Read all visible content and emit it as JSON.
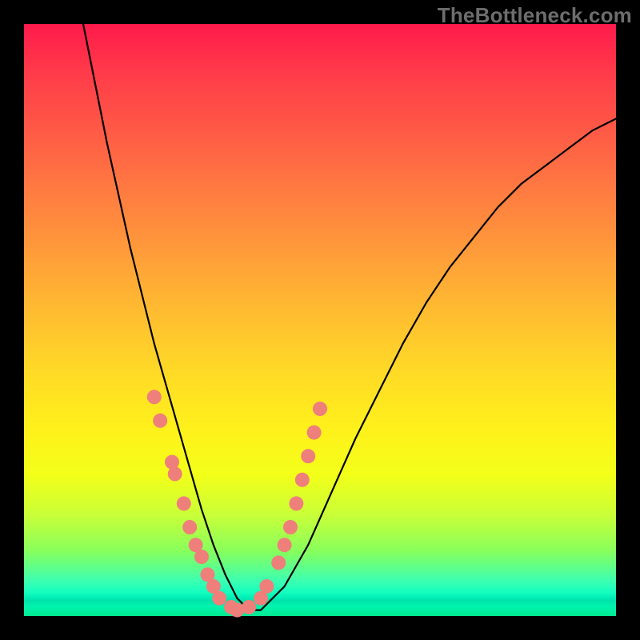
{
  "watermark": {
    "text": "TheBottleneck.com"
  },
  "chart_data": {
    "type": "line",
    "title": "",
    "xlabel": "",
    "ylabel": "",
    "xlim": [
      0,
      100
    ],
    "ylim": [
      0,
      100
    ],
    "grid": false,
    "description": "V-shaped bottleneck curve plotted over a vertical red-to-green gradient background, with salmon dots clustered near the valley.",
    "series": [
      {
        "name": "bottleneck-curve",
        "x": [
          10,
          12,
          14,
          16,
          18,
          20,
          22,
          24,
          26,
          28,
          30,
          32,
          34,
          36,
          38,
          40,
          44,
          48,
          52,
          56,
          60,
          64,
          68,
          72,
          76,
          80,
          84,
          88,
          92,
          96,
          100
        ],
        "y": [
          100,
          90,
          80,
          71,
          62,
          54,
          46,
          39,
          32,
          25,
          18,
          12,
          7,
          3,
          1,
          1,
          5,
          12,
          21,
          30,
          38,
          46,
          53,
          59,
          64,
          69,
          73,
          76,
          79,
          82,
          84
        ]
      }
    ],
    "valley_dots": {
      "comment": "Salmon dots near the curve valley; (x, y) in chart coordinates.",
      "points": [
        [
          22,
          37
        ],
        [
          23,
          33
        ],
        [
          25,
          26
        ],
        [
          25.5,
          24
        ],
        [
          27,
          19
        ],
        [
          28,
          15
        ],
        [
          29,
          12
        ],
        [
          30,
          10
        ],
        [
          31,
          7
        ],
        [
          32,
          5
        ],
        [
          33,
          3
        ],
        [
          35,
          1.5
        ],
        [
          36,
          1
        ],
        [
          38,
          1.5
        ],
        [
          40,
          3
        ],
        [
          41,
          5
        ],
        [
          43,
          9
        ],
        [
          44,
          12
        ],
        [
          45,
          15
        ],
        [
          46,
          19
        ],
        [
          47,
          23
        ],
        [
          48,
          27
        ],
        [
          49,
          31
        ],
        [
          50,
          35
        ]
      ],
      "radius_px": 9,
      "color": "#ef7f7a"
    }
  }
}
